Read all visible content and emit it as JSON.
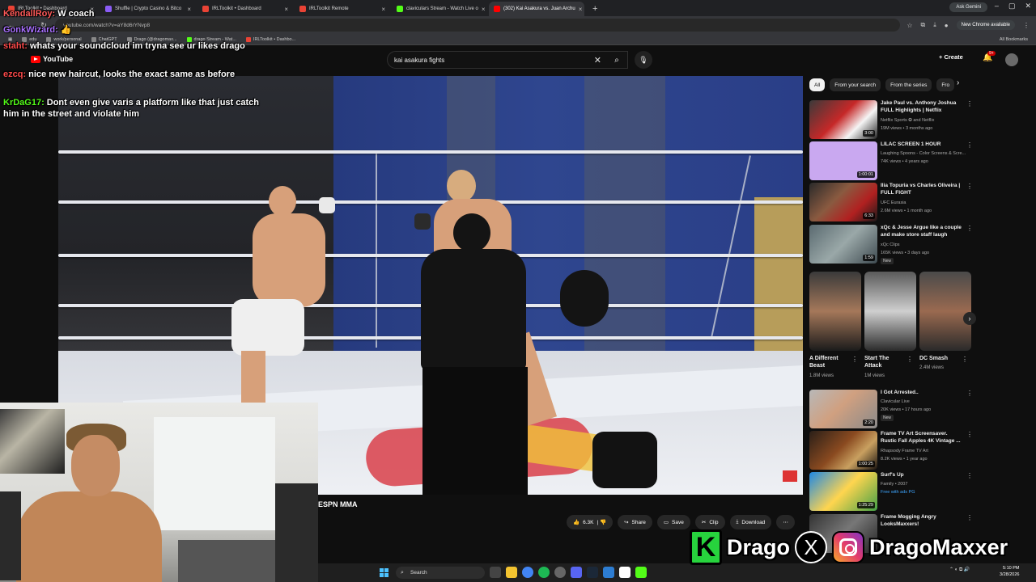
{
  "browser": {
    "tabs": [
      {
        "label": "IRLToolkit • Dashboard",
        "color": "#ea4335"
      },
      {
        "label": "Shuffle | Crypto Casino & Bitco",
        "color": "#8b5cf6"
      },
      {
        "label": "IRLToolkit • Dashboard",
        "color": "#ea4335"
      },
      {
        "label": "IRLToolkit Remote",
        "color": "#ea4335"
      },
      {
        "label": "claviculars Stream - Watch Live o",
        "color": "#53fc18"
      },
      {
        "label": "(302) Kai Asakura vs. Juan Archu",
        "color": "#ff0000"
      }
    ],
    "ask_gemini": "Ask Gemini",
    "url": "youtube.com/watch?v=aY8d6rYNvp8",
    "new_chrome": "New Chrome available",
    "bookmarks": [
      "edu",
      "work/personal",
      "ChatGPT",
      "Drago (@dragomax...",
      "drago Stream - Wat...",
      "IRLToolkit • Dashbo..."
    ],
    "all_bookmarks": "All Bookmarks"
  },
  "youtube": {
    "logo": "YouTube",
    "search_query": "kai asakura fights",
    "create": "Create",
    "notif_count": "9+",
    "video_channel": "ESPN MMA",
    "actions": {
      "likes": "6.3K",
      "share": "Share",
      "save": "Save",
      "clip": "Clip",
      "download": "Download"
    },
    "chips": [
      "All",
      "From your search",
      "From the series",
      "Fro"
    ],
    "recs": [
      {
        "title": "Jake Paul vs. Anthony Joshua FULL Highlights | Netflix",
        "channel": "Netflix Sports ✪ and Netflix",
        "meta": "19M views • 3 months ago",
        "duration": "3:00",
        "badge": ""
      },
      {
        "title": "LILAC SCREEN 1 HOUR",
        "channel": "Laughing Spoons - Color Screens & Scre...",
        "meta": "74K views • 4 years ago",
        "duration": "1:00:01",
        "badge": ""
      },
      {
        "title": "Ilia Topuria vs Charles Oliveira | FULL FIGHT",
        "channel": "UFC Eurasia",
        "meta": "2.6M views • 1 month ago",
        "duration": "6:33",
        "badge": ""
      },
      {
        "title": "xQc & Jesse Argue like a couple and make store staff laugh",
        "channel": "xQc Clips",
        "meta": "165K views • 3 days ago",
        "duration": "1:59",
        "badge": "New"
      },
      {
        "title": "I Got Arrested..",
        "channel": "Clavicular Live",
        "meta": "20K views • 17 hours ago",
        "duration": "2:20",
        "badge": "New"
      },
      {
        "title": "Frame TV Art Screensaver. Rustic Fall Apples 4K Vintage ...",
        "channel": "Rhapsody Frame TV Art",
        "meta": "8.2K views • 1 year ago",
        "duration": "1:00:25",
        "badge": ""
      },
      {
        "title": "Surf's Up",
        "channel": "Family • 2007",
        "meta": "Free with ads  PG",
        "duration": "1:25:29",
        "badge": ""
      },
      {
        "title": "Frame Mogging Angry LooksMaxxers!",
        "channel": "",
        "meta": "",
        "duration": "",
        "badge": ""
      }
    ],
    "shorts": [
      {
        "title": "A Different Beast",
        "views": "1.8M views"
      },
      {
        "title": "Start The Attack",
        "views": "1M views"
      },
      {
        "title": "DC Smash",
        "views": "2.4M views"
      }
    ]
  },
  "chat": [
    {
      "user": "KendallRoy:",
      "text": "W coach",
      "color": "#ff5a5a"
    },
    {
      "user": "GonkWizard:",
      "text": "👍",
      "color": "#a970ff"
    },
    {
      "user": "staht:",
      "text": "whats your soundcloud im tryna see ur likes drago",
      "color": "#ff4a4a"
    },
    {
      "user": "ezcq:",
      "text": "nice new haircut, looks the exact same as before",
      "color": "#ff4a4a"
    },
    {
      "user": "KrDaG17:",
      "text": "Dont even give varis a platform like that just catch him in the street and violate him",
      "color": "#53fc18"
    }
  ],
  "overlay": {
    "brand_k": "K",
    "brand_left": "Drago",
    "brand_x": "X",
    "brand_right": "DragoMaxxer"
  },
  "taskbar": {
    "search": "Search",
    "time": "5:10 PM",
    "date": "3/28/2026"
  }
}
